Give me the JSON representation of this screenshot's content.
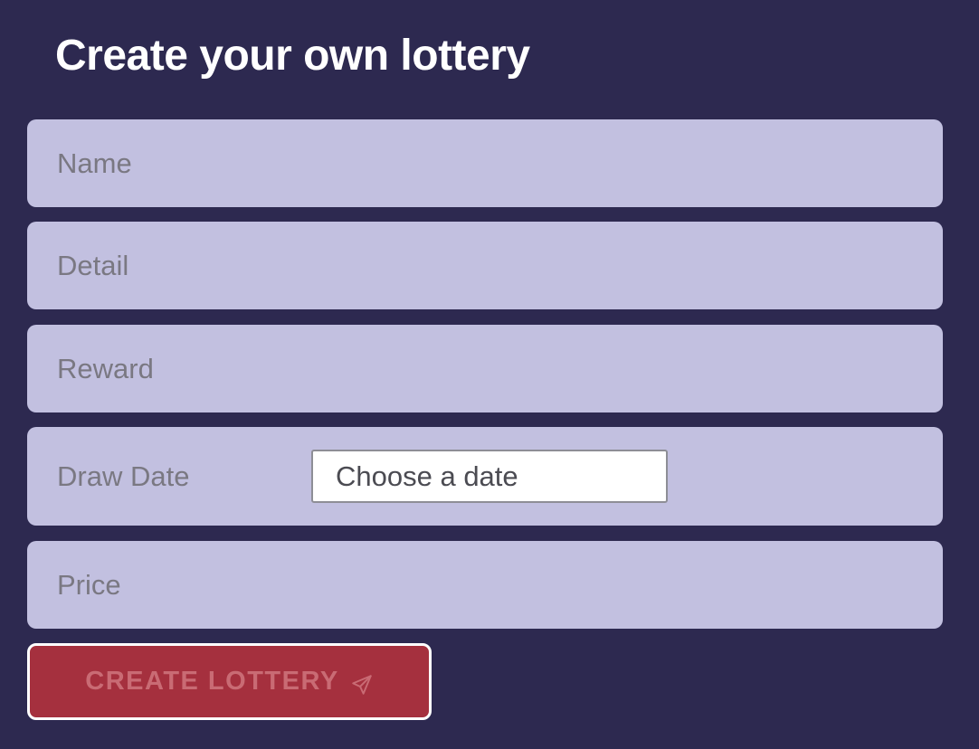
{
  "form": {
    "title": "Create your own lottery",
    "name_placeholder": "Name",
    "detail_placeholder": "Detail",
    "reward_placeholder": "Reward",
    "draw_date_label": "Draw Date",
    "draw_date_placeholder": "Choose a date",
    "price_placeholder": "Price",
    "submit_label": "CREATE LOTTERY",
    "submit_icon": "send-icon"
  },
  "colors": {
    "background": "#2d2950",
    "field": "#c2c0e0",
    "button": "#a5303e",
    "button_text": "#c96b74",
    "title_text": "#ffffff"
  }
}
